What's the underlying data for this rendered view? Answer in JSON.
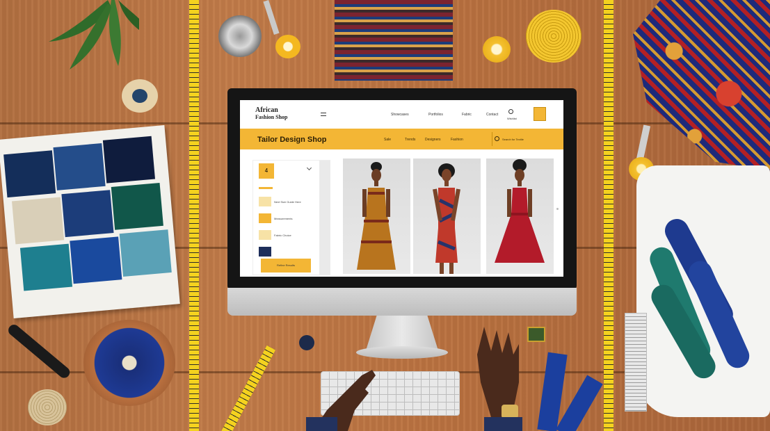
{
  "screen": {
    "logo": {
      "line1": "African",
      "line2": "Fashion Shop"
    },
    "nav": {
      "items": [
        "Showcases",
        "Portfolios",
        "Fabric",
        "Contact"
      ],
      "extra_label": "Wishlist"
    },
    "hero": {
      "title": "Tailor Design Shop",
      "links": [
        "Sale",
        "Trends",
        "Designers",
        "Fashion"
      ],
      "search_placeholder": "Search for Textile"
    },
    "sidebar": {
      "selected_size": "4",
      "filters": [
        "Next Size Guide Here",
        "Measurements",
        "Fabric Choice"
      ],
      "apply_label": "Refine Results"
    },
    "products": [
      {
        "dress": "African print dress",
        "color": "#b8741e"
      },
      {
        "dress": "Patterned sheath dress",
        "color": "#c0392b"
      },
      {
        "dress": "Red fit and flare dress",
        "color": "#b31b2a"
      }
    ]
  },
  "colors": {
    "accent": "#f3b635",
    "desk": "#b06e40",
    "screen_bg": "#ffffff"
  }
}
